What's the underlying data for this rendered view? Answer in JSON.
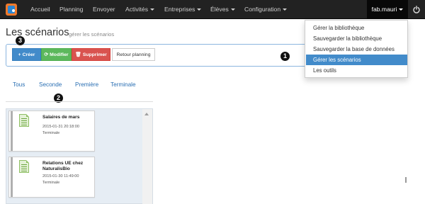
{
  "navbar": {
    "items": [
      {
        "label": "Accueil",
        "caret": false
      },
      {
        "label": "Planning",
        "caret": false
      },
      {
        "label": "Envoyer",
        "caret": false
      },
      {
        "label": "Activités",
        "caret": true
      },
      {
        "label": "Entreprises",
        "caret": true
      },
      {
        "label": "Élèves",
        "caret": true
      },
      {
        "label": "Configuration",
        "caret": true
      }
    ],
    "user": "fab.mauri",
    "brand_icon": "app-logo-icon",
    "power_icon": "power-icon"
  },
  "page": {
    "title": "Les scénarios",
    "subtitle": "gérer les scénarios"
  },
  "toolbar": {
    "create": {
      "icon": "+",
      "label": "Créer"
    },
    "edit": {
      "icon": "⟳",
      "label": "Modifier"
    },
    "delete": {
      "icon": "🗑",
      "label": "Supprimer"
    },
    "back": {
      "label": "Retour planning"
    }
  },
  "tabs": [
    "Tous",
    "Seconde",
    "Première",
    "Terminale"
  ],
  "scenarios": [
    {
      "name_line1": "Salaires de mars",
      "name_line2": "",
      "date": "2015-01-31 20:18:00",
      "level": "Terminale"
    },
    {
      "name_line1": "Relations UE chez",
      "name_line2": "NaturalisBio",
      "date": "2015-01-30 11:49:00",
      "level": "Terminale"
    }
  ],
  "dropdown": {
    "items": [
      {
        "label": "Gérer la bibliothèque",
        "active": false
      },
      {
        "label": "Sauvegarder la bibliothèque",
        "active": false
      },
      {
        "label": "Sauvegarder la base de données",
        "active": false
      },
      {
        "label": "Gérer les scénarios",
        "active": true
      },
      {
        "label": "Les outils",
        "active": false
      }
    ]
  },
  "badges": [
    "❶",
    "❷",
    "❸"
  ],
  "colors": {
    "navbar": "#222222",
    "primary": "#428bca",
    "success": "#5cb85c",
    "danger": "#d9534f",
    "link": "#2a6fb3"
  }
}
